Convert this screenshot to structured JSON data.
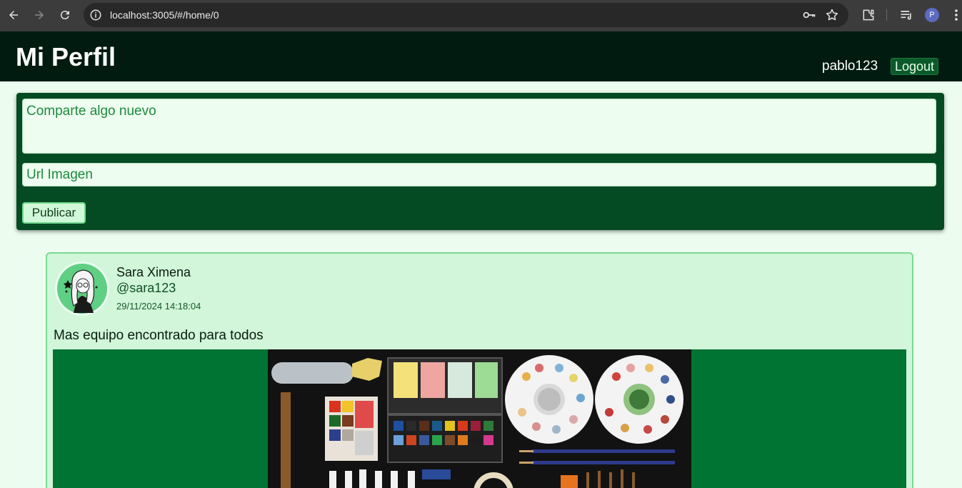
{
  "browser": {
    "url": "localhost:3005/#/home/0",
    "profile_initial": "P",
    "icons": [
      "back-icon",
      "forward-icon",
      "reload-icon",
      "site-info-icon",
      "key-icon",
      "star-icon",
      "extensions-icon",
      "reading-list-icon",
      "more-vert-icon"
    ]
  },
  "header": {
    "title": "Mi Perfil",
    "username": "pablo123",
    "logout_label": "Logout"
  },
  "composer": {
    "text_placeholder": "Comparte algo nuevo",
    "url_placeholder": "Url Imagen",
    "publish_label": "Publicar"
  },
  "post": {
    "author_name": "Sara Ximena",
    "author_handle": "@sara123",
    "timestamp": "29/11/2024 14:18:04",
    "text": "Mas equipo encontrado para todos",
    "image_alt": "watercolor-supplies-photo"
  },
  "colors": {
    "header_bg": "#011b10",
    "composer_bg": "#044a22",
    "page_bg": "#ecfdf0",
    "card_bg": "#d1f6d9",
    "media_bg": "#007432",
    "accent": "#1e8a3b"
  }
}
